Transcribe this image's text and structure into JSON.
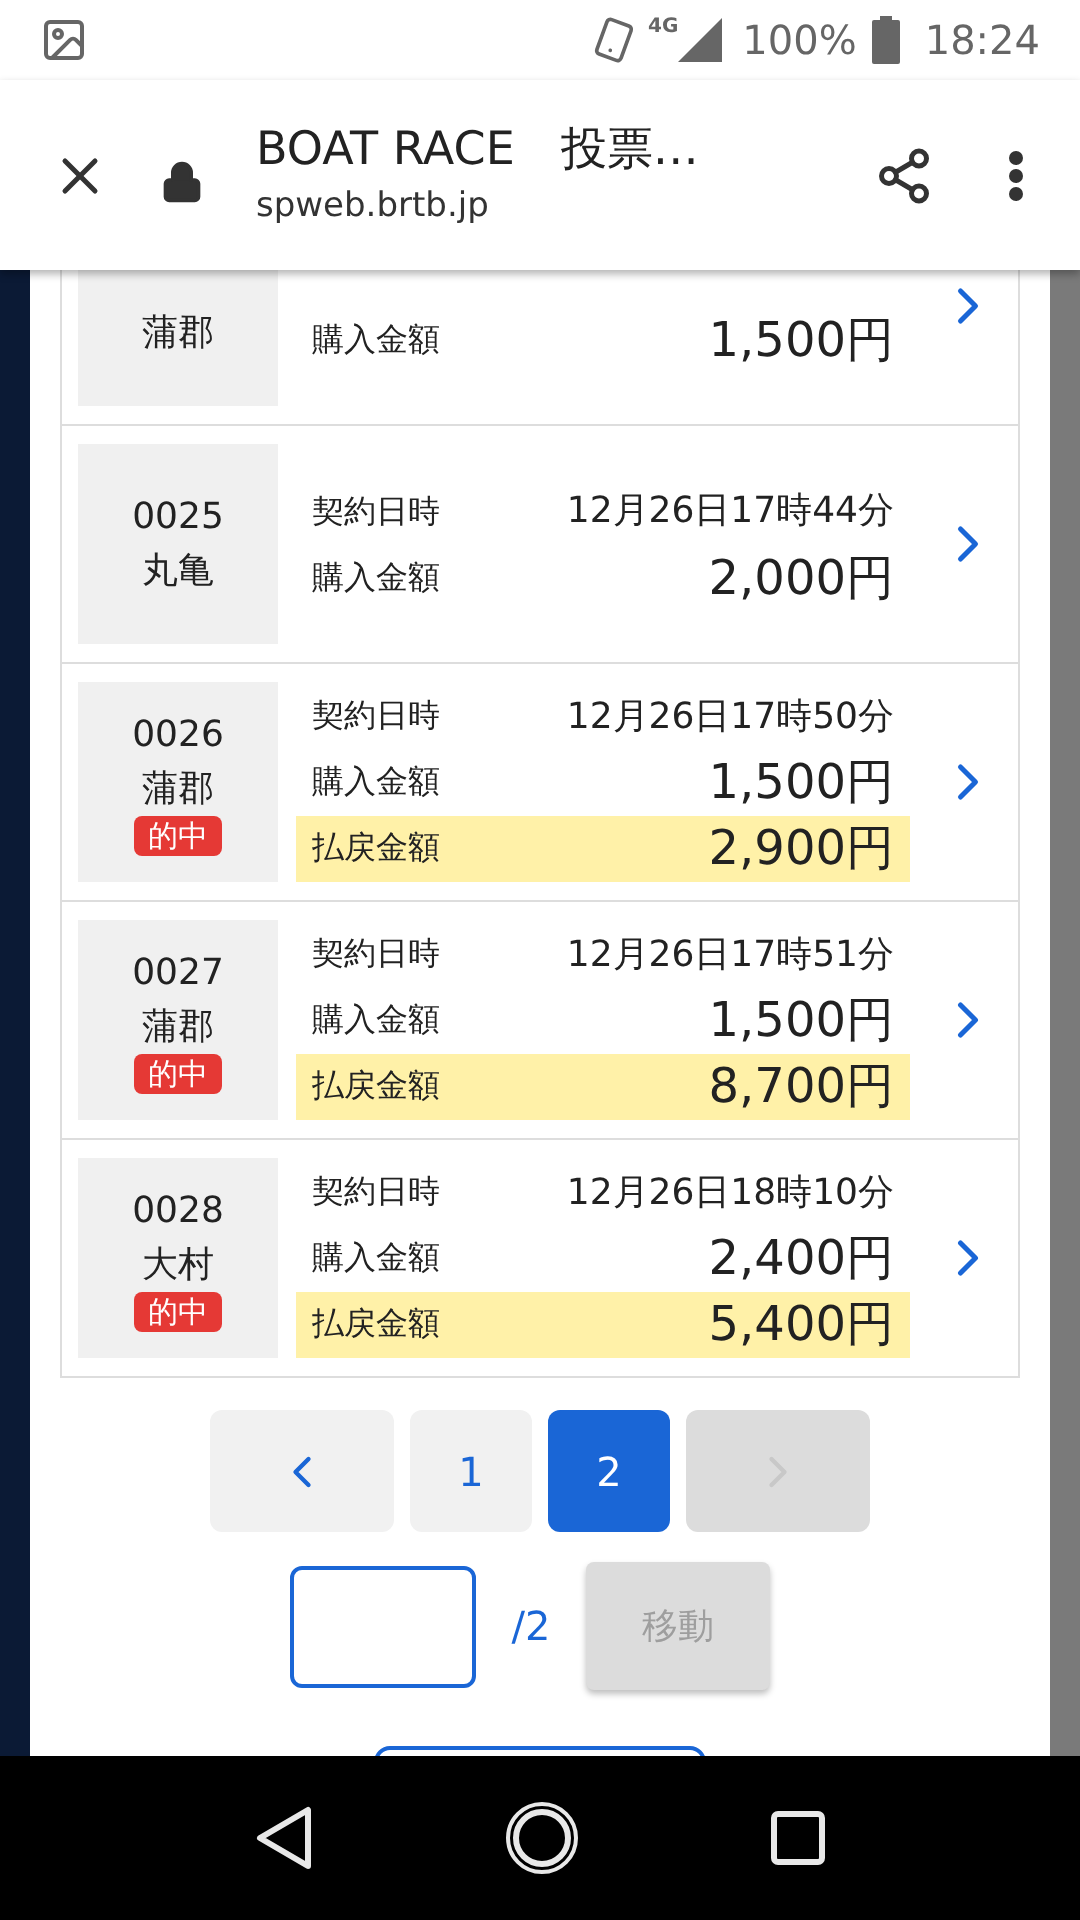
{
  "status_bar": {
    "network": "4G",
    "battery": "100%",
    "time": "18:24"
  },
  "browser": {
    "title": "BOAT RACE　投票…",
    "url": "spweb.brtb.jp"
  },
  "tickets": [
    {
      "venue": "蒲郡",
      "amount_label": "購入金額",
      "amount": "1,500円"
    },
    {
      "number": "0025",
      "venue": "丸亀",
      "date_label": "契約日時",
      "date": "12月26日17時44分",
      "amount_label": "購入金額",
      "amount": "2,000円"
    },
    {
      "number": "0026",
      "venue": "蒲郡",
      "badge": "的中",
      "date_label": "契約日時",
      "date": "12月26日17時50分",
      "amount_label": "購入金額",
      "amount": "1,500円",
      "payout_label": "払戻金額",
      "payout": "2,900円"
    },
    {
      "number": "0027",
      "venue": "蒲郡",
      "badge": "的中",
      "date_label": "契約日時",
      "date": "12月26日17時51分",
      "amount_label": "購入金額",
      "amount": "1,500円",
      "payout_label": "払戻金額",
      "payout": "8,700円"
    },
    {
      "number": "0028",
      "venue": "大村",
      "badge": "的中",
      "date_label": "契約日時",
      "date": "12月26日18時10分",
      "amount_label": "購入金額",
      "amount": "2,400円",
      "payout_label": "払戻金額",
      "payout": "5,400円"
    }
  ],
  "pagination": {
    "prev_disabled": false,
    "next_disabled": true,
    "pages": [
      {
        "label": "1",
        "selected": false
      },
      {
        "label": "2",
        "selected": true
      }
    ]
  },
  "page_jump": {
    "total": "/2",
    "button": "移動",
    "button_disabled": true
  }
}
